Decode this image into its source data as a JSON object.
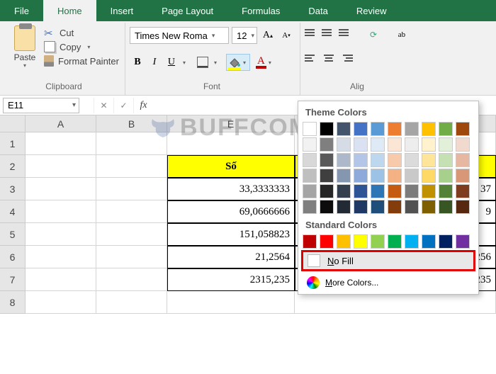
{
  "tabs": {
    "file": "File",
    "home": "Home",
    "insert": "Insert",
    "pageLayout": "Page Layout",
    "formulas": "Formulas",
    "data": "Data",
    "review": "Review"
  },
  "clipboard": {
    "paste": "Paste",
    "cut": "Cut",
    "copy": "Copy",
    "formatPainter": "Format Painter",
    "groupLabel": "Clipboard"
  },
  "font": {
    "name": "Times New Roma",
    "size": "12",
    "groupLabel": "Font"
  },
  "alignment": {
    "groupLabel": "Alig"
  },
  "nameBox": "E11",
  "popup": {
    "themeColors": "Theme Colors",
    "standardColors": "Standard Colors",
    "noFill": "No Fill",
    "moreColors": "More Colors..."
  },
  "sheet": {
    "cols": [
      "A",
      "B",
      "E"
    ],
    "rows": [
      "1",
      "2",
      "3",
      "4",
      "5",
      "6",
      "7",
      "8"
    ],
    "headerE": "Số",
    "valuesE": [
      "33,3333333",
      "69,0666666",
      "151,058823",
      "21,2564",
      "2315,235"
    ],
    "valuesRight": [
      "37",
      "9",
      "21,256",
      "2315,235"
    ]
  },
  "watermark": "BUFFCOM"
}
